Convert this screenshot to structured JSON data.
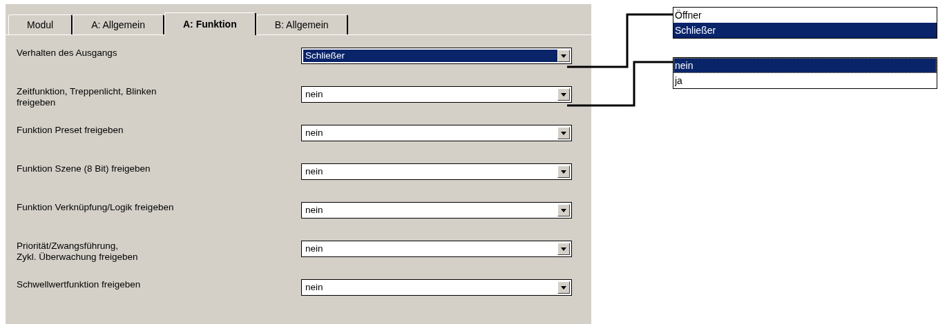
{
  "tabs": [
    {
      "label": "Modul",
      "selected": false
    },
    {
      "label": "A: Allgemein",
      "selected": false
    },
    {
      "label": "A: Funktion",
      "selected": true
    },
    {
      "label": "B: Allgemein",
      "selected": false
    }
  ],
  "parameters": [
    {
      "label": "Verhalten des Ausgangs",
      "value": "Schließer",
      "focused": true
    },
    {
      "label": "Zeitfunktion, Treppenlicht, Blinken\nfreigeben",
      "value": "nein",
      "focused": false
    },
    {
      "label": "Funktion Preset freigeben",
      "value": "nein",
      "focused": false
    },
    {
      "label": "Funktion Szene (8 Bit) freigeben",
      "value": "nein",
      "focused": false
    },
    {
      "label": "Funktion Verknüpfung/Logik freigeben",
      "value": "nein",
      "focused": false
    },
    {
      "label": "Priorität/Zwangsführung,\nZykl. Überwachung freigeben",
      "value": "nein",
      "focused": false
    },
    {
      "label": "Schwellwertfunktion freigeben",
      "value": "nein",
      "focused": false
    }
  ],
  "option_lists": [
    {
      "options": [
        {
          "label": "Öffner",
          "selected": false
        },
        {
          "label": "Schließer",
          "selected": true
        }
      ],
      "focused": false
    },
    {
      "options": [
        {
          "label": "nein",
          "selected": true
        },
        {
          "label": "ja",
          "selected": false
        }
      ],
      "focused": true
    }
  ]
}
